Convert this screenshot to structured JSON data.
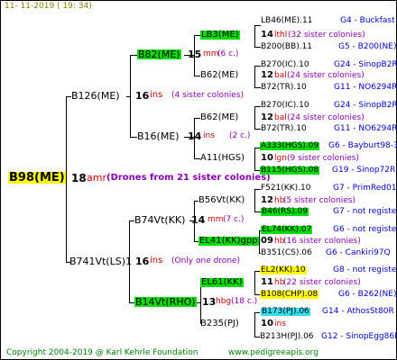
{
  "header": {
    "date": "11-  11-2019  ( 19: 34)"
  },
  "footer": {
    "copyright": "Copyright 2004-2019 @ Karl Kehrle Foundation",
    "url": "www.pedigreeapis.org"
  },
  "colors": {
    "yellow": "#ffff00",
    "green": "#00dd00",
    "cyan": "#33ddee",
    "red": "#cc0000",
    "blue": "#0000cc"
  },
  "gen1": {
    "name": "B98(ME)",
    "num": "18",
    "breed": "amr",
    "note": "(Drones from 21 sister colonies)"
  },
  "gen2": [
    {
      "name": "B126(ME)",
      "num": "16",
      "breed": "ins",
      "note": "(4 sister colonies)"
    },
    {
      "name": "B741Vt(LS)1",
      "num": "16",
      "breed": "ins",
      "note": "(Only one drone)"
    }
  ],
  "gen3": [
    {
      "name": "B82(ME)",
      "num": "15",
      "breed": "mm",
      "note": "(6 c.)"
    },
    {
      "name": "B16(ME)",
      "num": "14",
      "breed": "ins",
      "note": "(2 c.)"
    },
    {
      "name": "B74Vt(KK)",
      "num": "14",
      "breed": "mm",
      "note": "(7 c.)"
    },
    {
      "name": "B14Vt(RHO)",
      "num": "13",
      "breed": "hbg",
      "note": "(18 c.)"
    }
  ],
  "gen4": [
    {
      "name": "LB3(ME)",
      "num": "14",
      "breed": "lthl",
      "note": "(32 sister colonies)"
    },
    {
      "name": "B62(ME)",
      "num": "12",
      "breed": "bal",
      "note": "(24 sister colonies)"
    },
    {
      "name": "B62(ME)",
      "num": "12",
      "breed": "bal",
      "note": "(24 sister colonies)"
    },
    {
      "name": "A11(HGS)",
      "num": "10",
      "breed": "lgn",
      "note": "(9 sister colonies)"
    },
    {
      "name": "B56Vt(KK)",
      "num": "12",
      "breed": "hb",
      "note": "(5 sister colonies)"
    },
    {
      "name": "EL41(KK)gpp",
      "num": "09",
      "breed": "hb",
      "note": "(16 sister colonies)"
    },
    {
      "name": "EL61(KK)",
      "num": "11",
      "breed": "hb",
      "note": "(22 sister colonies)"
    },
    {
      "name": "B235(PJ)",
      "num": "10",
      "breed": "ins",
      "note": ""
    }
  ],
  "gen5": [
    {
      "name": "LB46(ME).11",
      "tag": "G4 - Buckfast"
    },
    {
      "name": "B200(BB).11",
      "tag": "G5 - B200(NE)"
    },
    {
      "name": "B270(IC).10",
      "tag": "G24 - SinopB2R"
    },
    {
      "name": "B72(TR).10",
      "tag": "G11 - NO6294R"
    },
    {
      "name": "B270(IC).10",
      "tag": "G24 - SinopB2R"
    },
    {
      "name": "B72(TR).10",
      "tag": "G11 - NO6294R"
    },
    {
      "name": "A333(HGS).09",
      "tag": "G6 - Bayburt98-3"
    },
    {
      "name": "B115(HGS).08",
      "tag": "G19 - Sinop72R"
    },
    {
      "name": "F521(KK).10",
      "tag": "G7 - PrimRed01"
    },
    {
      "name": "B46(RS).09",
      "tag": "G7 - not registe"
    },
    {
      "name": "EL74(KK).07",
      "tag": "G6 - not registe"
    },
    {
      "name": "B351(CS).06",
      "tag": "G6 - Cankiri97Q"
    },
    {
      "name": "EL2(KK).10",
      "tag": "G8 - not registe"
    },
    {
      "name": "B108(CHP).08",
      "tag": "G6 - B262(NE)"
    },
    {
      "name": "B173(PJ).06",
      "tag": "G14 - AthosSt80R"
    },
    {
      "name": "B213H(PJ).06",
      "tag": "G12 - SinopEgg86R"
    }
  ]
}
